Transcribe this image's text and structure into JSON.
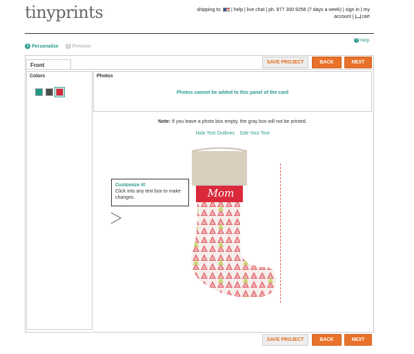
{
  "brand": {
    "logo_text": "tinyprints",
    "logo_mark": "."
  },
  "topnav": {
    "shipping_label": "shipping to:",
    "help": "help",
    "live_chat": "live chat",
    "phone": "ph. 877 300 9256 (7 days a week)",
    "sign_in": "sign in",
    "account": "my account",
    "cart": "cart"
  },
  "steps": [
    {
      "num": "1",
      "label": "Personalize"
    },
    {
      "num": "2",
      "label": "Preview"
    }
  ],
  "help_link": "Help",
  "tab": {
    "label": "Front"
  },
  "toolbar": {
    "save_label": "SAVE PROJECT",
    "back_label": "BACK",
    "next_label": "NEXT"
  },
  "colors_panel": {
    "title": "Colors",
    "swatches": [
      "#1f9a85",
      "#4a4f4c",
      "#d9293b"
    ]
  },
  "photos_panel": {
    "title": "Photos",
    "message": "Photos cannot be added to this panel of the card"
  },
  "note": {
    "label": "Note:",
    "text": "If you leave a photo box empty, the gray box will not be printed."
  },
  "links": {
    "hide_outlines": "Hide Text Outlines",
    "edit_text": "Edit Your Text"
  },
  "stocking": {
    "name": "Mom"
  },
  "tooltip": {
    "title": "Customize it!",
    "body": "Click into any text box to make changes."
  }
}
